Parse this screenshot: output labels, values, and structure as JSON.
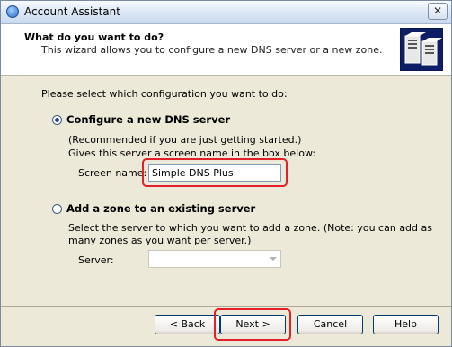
{
  "window": {
    "title": "Account Assistant",
    "close_glyph": "✕"
  },
  "header": {
    "title": "What do you want to do?",
    "subtitle": "This wizard allows you to configure a new DNS server or a new zone."
  },
  "content": {
    "prompt": "Please select which configuration you want to do:",
    "option_new_server": {
      "label": "Configure a new DNS server",
      "selected": true,
      "desc1": "(Recommended if you are just getting started.)",
      "desc2": "Gives this server a screen name in the box below:",
      "field_label": "Screen name:",
      "field_value": "Simple DNS Plus"
    },
    "option_add_zone": {
      "label": "Add a zone to an existing server",
      "selected": false,
      "desc1": "Select the server to which you want to add a zone. (Note: you can add as",
      "desc2": "many zones as you want per server.)",
      "field_label": "Server:",
      "field_value": ""
    }
  },
  "buttons": {
    "back": "< Back",
    "next": "Next >",
    "cancel": "Cancel",
    "help": "Help"
  },
  "colors": {
    "highlight": "#e3202a",
    "header_icon_bg": "#0d1e66"
  }
}
